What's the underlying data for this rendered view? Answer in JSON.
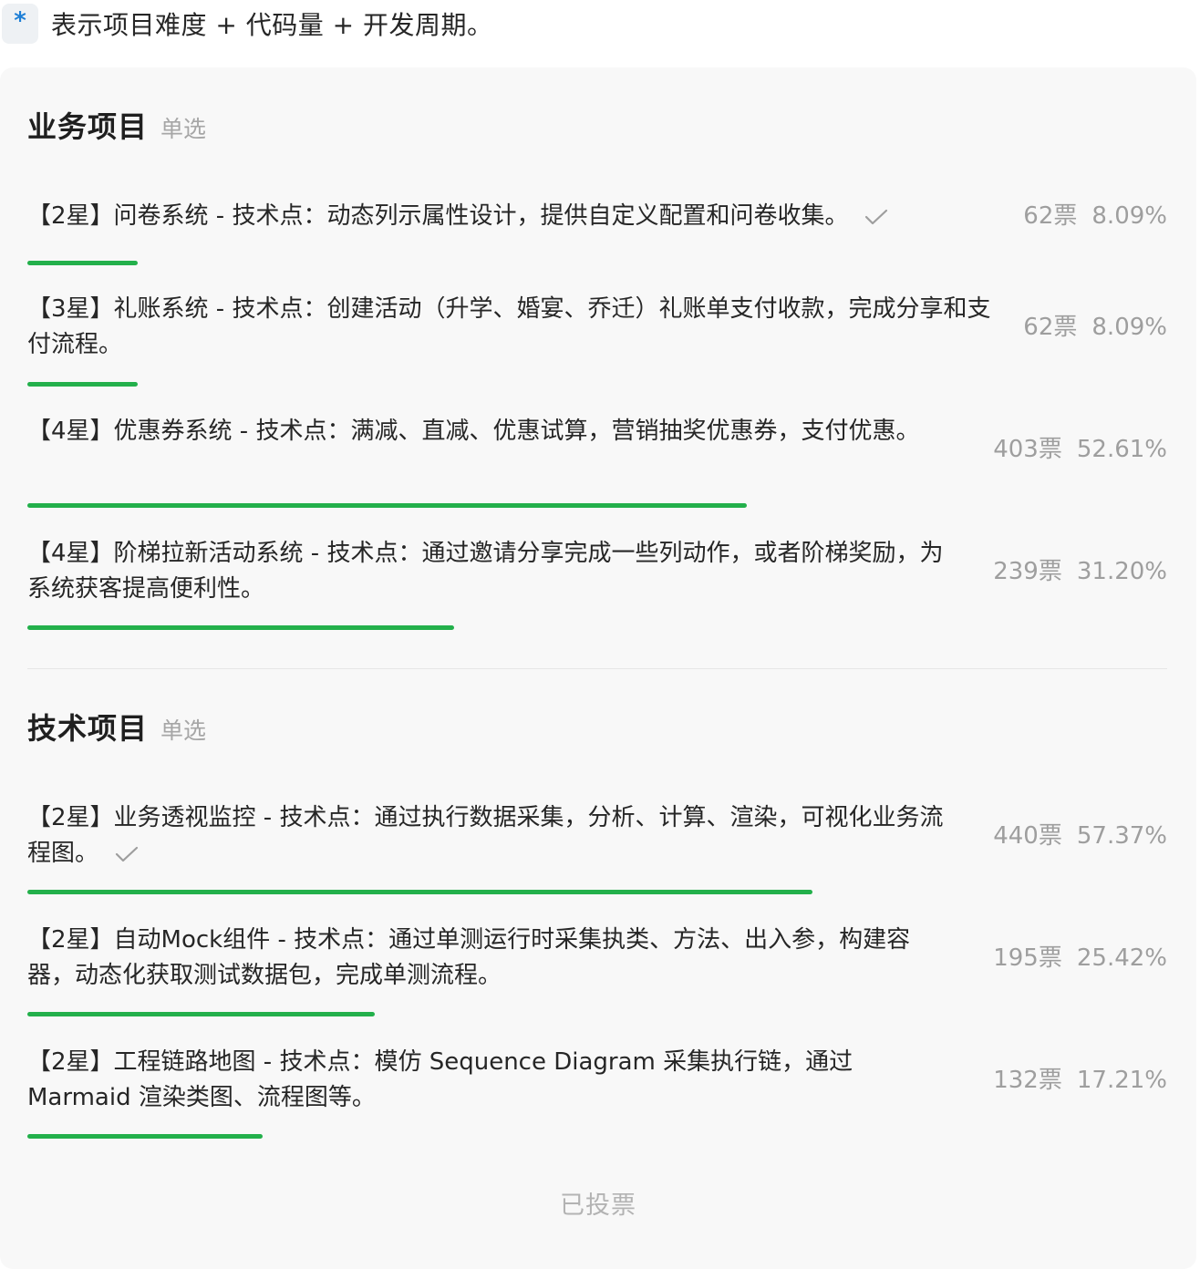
{
  "note": {
    "icon": "asterisk-icon",
    "text": "表示项目难度 + 代码量 + 开发周期。"
  },
  "colors": {
    "bar": "#23b04b",
    "note_icon": "#1e7fd6"
  },
  "sections": [
    {
      "title": "业务项目",
      "mode": "单选",
      "options": [
        {
          "text": "【2星】问卷系统 - 技术点：动态列示属性设计，提供自定义配置和问卷收集。",
          "votes": "62票",
          "percent": "8.09%",
          "fraction": 0.0809,
          "selected": true
        },
        {
          "text": "【3星】礼账系统 - 技术点：创建活动（升学、婚宴、乔迁）礼账单支付收款，完成分享和支付流程。",
          "votes": "62票",
          "percent": "8.09%",
          "fraction": 0.0809,
          "selected": false
        },
        {
          "text": "【4星】优惠券系统 - 技术点：满减、直减、优惠试算，营销抽奖优惠券，支付优惠。",
          "votes": "403票",
          "percent": "52.61%",
          "fraction": 0.5261,
          "selected": false
        },
        {
          "text": "【4星】阶梯拉新活动系统 - 技术点：通过邀请分享完成一些列动作，或者阶梯奖励，为系统获客提高便利性。",
          "votes": "239票",
          "percent": "31.20%",
          "fraction": 0.312,
          "selected": false
        }
      ]
    },
    {
      "title": "技术项目",
      "mode": "单选",
      "options": [
        {
          "text": "【2星】业务透视监控 - 技术点：通过执行数据采集，分析、计算、渲染，可视化业务流程图。",
          "votes": "440票",
          "percent": "57.37%",
          "fraction": 0.5737,
          "selected": true
        },
        {
          "text": "【2星】自动Mock组件 - 技术点：通过单测运行时采集执类、方法、出入参，构建容器，动态化获取测试数据包，完成单测流程。",
          "votes": "195票",
          "percent": "25.42%",
          "fraction": 0.2542,
          "selected": false
        },
        {
          "text": "【2星】工程链路地图 - 技术点：模仿 Sequence Diagram 采集执行链，通过 Marmaid 渲染类图、流程图等。",
          "votes": "132票",
          "percent": "17.21%",
          "fraction": 0.1721,
          "selected": false
        }
      ]
    }
  ],
  "footer": {
    "voted_label": "已投票"
  }
}
